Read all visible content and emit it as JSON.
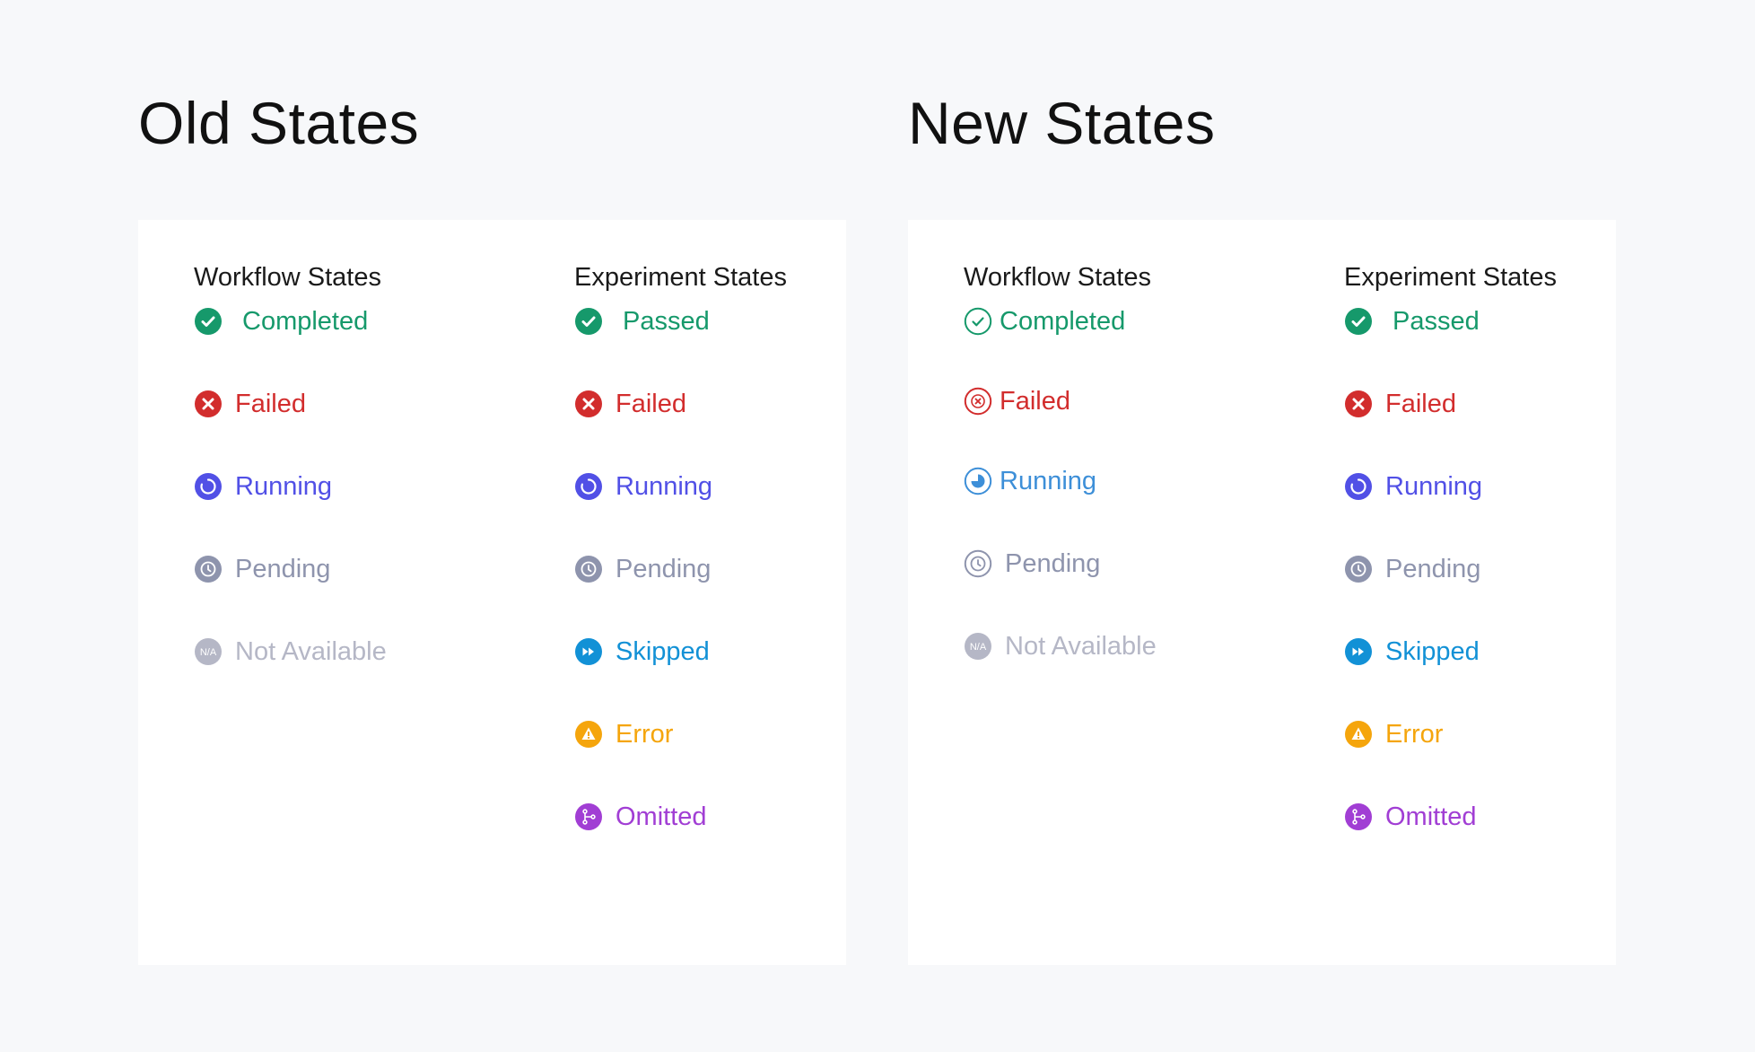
{
  "old": {
    "title": "Old States",
    "workflow": {
      "title": "Workflow States",
      "states": [
        {
          "label": "Completed",
          "icon": "check-circle-filled-icon",
          "color": "#16996b",
          "gap": 22
        },
        {
          "label": "Failed",
          "icon": "x-circle-filled-icon",
          "color": "#d22d2d",
          "gap": 14
        },
        {
          "label": "Running",
          "icon": "spinner-circle-filled-icon",
          "color": "#5150e6",
          "gap": 14
        },
        {
          "label": "Pending",
          "icon": "clock-circle-filled-icon",
          "color": "#8e94ad",
          "gap": 14
        },
        {
          "label": "Not Available",
          "icon": "na-circle-filled-icon",
          "color": "#b5b7c6",
          "gap": 14
        }
      ]
    },
    "experiment": {
      "title": "Experiment States",
      "states": [
        {
          "label": "Passed",
          "icon": "check-circle-filled-icon",
          "color": "#16996b",
          "gap": 22
        },
        {
          "label": "Failed",
          "icon": "x-circle-filled-icon",
          "color": "#d22d2d",
          "gap": 14
        },
        {
          "label": "Running",
          "icon": "spinner-circle-filled-icon",
          "color": "#5150e6",
          "gap": 14
        },
        {
          "label": "Pending",
          "icon": "clock-circle-filled-icon",
          "color": "#8e94ad",
          "gap": 14
        },
        {
          "label": "Skipped",
          "icon": "fast-forward-circle-filled-icon",
          "color": "#1291d6",
          "gap": 14
        },
        {
          "label": "Error",
          "icon": "warning-circle-filled-icon",
          "color": "#f5a50c",
          "gap": 14
        },
        {
          "label": "Omitted",
          "icon": "branch-circle-filled-icon",
          "color": "#a13ed4",
          "gap": 14
        }
      ]
    }
  },
  "new": {
    "title": "New States",
    "workflow": {
      "title": "Workflow States",
      "states": [
        {
          "label": "Completed",
          "icon": "check-circle-outline-icon",
          "color": "#16996b",
          "gap": 8
        },
        {
          "label": "Failed",
          "icon": "x-circle-outline-icon",
          "color": "#d22d2d",
          "gap": 8
        },
        {
          "label": "Running",
          "icon": "pie-progress-circle-outline-icon",
          "color": "#3d8fd8",
          "gap": 8
        },
        {
          "label": "Pending",
          "icon": "clock-circle-outline-icon",
          "color": "#8e94ad",
          "gap": 14
        },
        {
          "label": "Not Available",
          "icon": "na-circle-filled-icon",
          "color": "#b5b7c6",
          "gap": 14
        }
      ]
    },
    "experiment": {
      "title": "Experiment States",
      "states": [
        {
          "label": "Passed",
          "icon": "check-circle-filled-icon",
          "color": "#16996b",
          "gap": 22
        },
        {
          "label": "Failed",
          "icon": "x-circle-filled-icon",
          "color": "#d22d2d",
          "gap": 14
        },
        {
          "label": "Running",
          "icon": "spinner-circle-filled-icon",
          "color": "#5150e6",
          "gap": 14
        },
        {
          "label": "Pending",
          "icon": "clock-circle-filled-icon",
          "color": "#8e94ad",
          "gap": 14
        },
        {
          "label": "Skipped",
          "icon": "fast-forward-circle-filled-icon",
          "color": "#1291d6",
          "gap": 14
        },
        {
          "label": "Error",
          "icon": "warning-circle-filled-icon",
          "color": "#f5a50c",
          "gap": 14
        },
        {
          "label": "Omitted",
          "icon": "branch-circle-filled-icon",
          "color": "#a13ed4",
          "gap": 14
        }
      ]
    }
  }
}
